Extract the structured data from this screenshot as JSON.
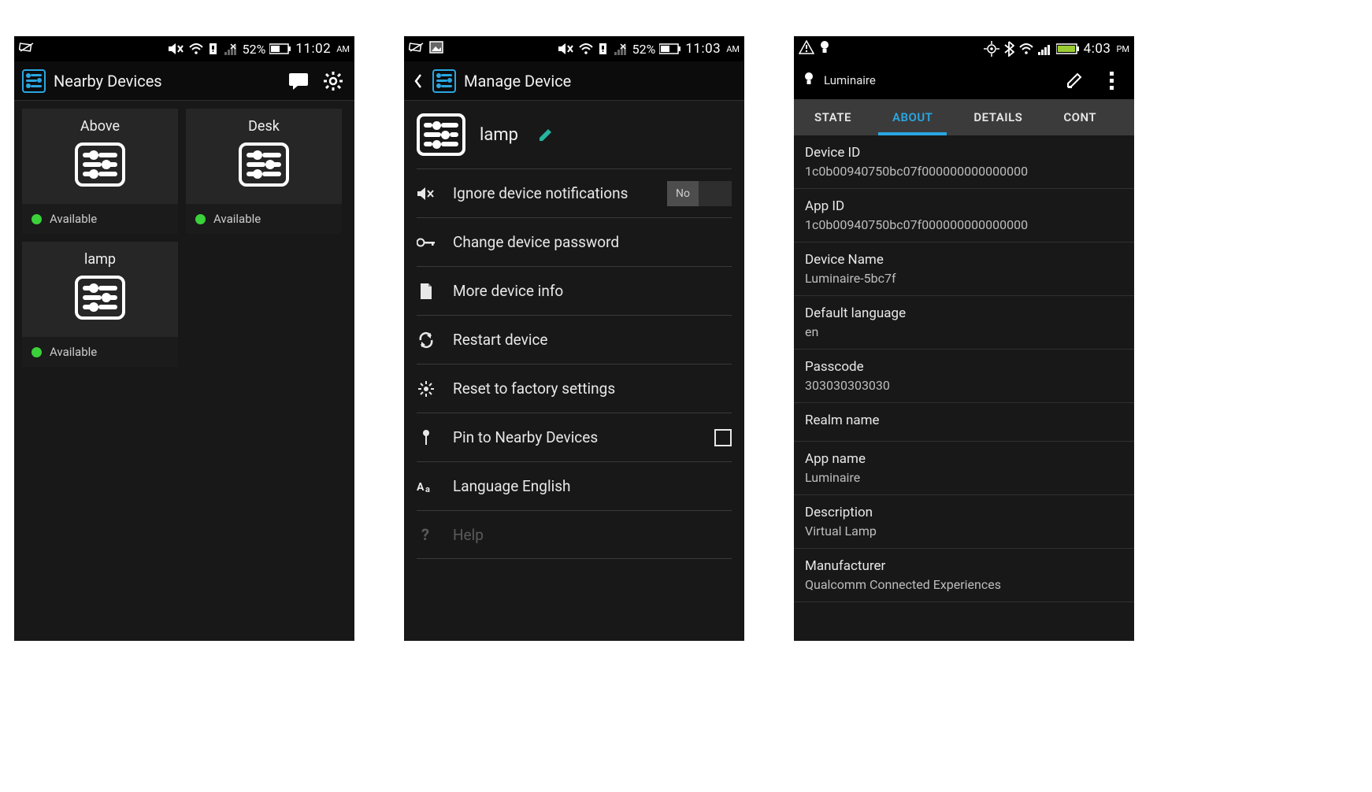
{
  "screen1": {
    "status": {
      "battery": "52%",
      "time": "11:02",
      "ampm": "AM"
    },
    "title": "Nearby Devices",
    "devices": [
      {
        "name": "Above",
        "status": "Available"
      },
      {
        "name": "Desk",
        "status": "Available"
      },
      {
        "name": "lamp",
        "status": "Available"
      }
    ]
  },
  "screen2": {
    "status": {
      "battery": "52%",
      "time": "11:03",
      "ampm": "AM"
    },
    "title": "Manage Device",
    "device_name": "lamp",
    "toggle_no": "No",
    "rows": {
      "ignore": "Ignore device notifications",
      "password": "Change device password",
      "info": "More device info",
      "restart": "Restart device",
      "reset": "Reset to factory settings",
      "pin": "Pin to Nearby Devices",
      "language": "Language English",
      "help": "Help"
    }
  },
  "screen3": {
    "status": {
      "time": "4:03",
      "ampm": "PM"
    },
    "title": "Luminaire",
    "tabs": {
      "state": "STATE",
      "about": "ABOUT",
      "details": "DETAILS",
      "cont": "CONT"
    },
    "fields": [
      {
        "label": "Device ID",
        "value": "1c0b00940750bc07f000000000000000"
      },
      {
        "label": "App ID",
        "value": "1c0b00940750bc07f000000000000000"
      },
      {
        "label": "Device Name",
        "value": "Luminaire-5bc7f"
      },
      {
        "label": "Default language",
        "value": "en"
      },
      {
        "label": "Passcode",
        "value": "303030303030"
      },
      {
        "label": "Realm name",
        "value": ""
      },
      {
        "label": "App name",
        "value": "Luminaire"
      },
      {
        "label": "Description",
        "value": "Virtual Lamp"
      },
      {
        "label": "Manufacturer",
        "value": "Qualcomm Connected Experiences"
      }
    ]
  }
}
